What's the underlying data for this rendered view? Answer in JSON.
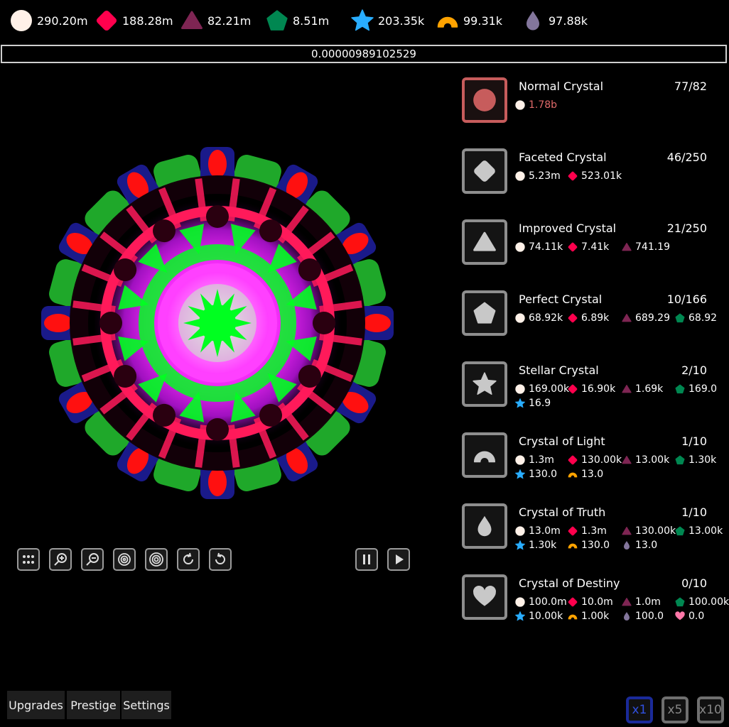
{
  "resources": [
    {
      "name": "circle",
      "value": "290.20m",
      "color": "#fff1e8"
    },
    {
      "name": "diamond",
      "value": "188.28m",
      "color": "#ff004d"
    },
    {
      "name": "triangle",
      "value": "82.21m",
      "color": "#7e2553"
    },
    {
      "name": "pentagon",
      "value": "8.51m",
      "color": "#008751"
    },
    {
      "name": "star",
      "value": "203.35k",
      "color": "#29adff"
    },
    {
      "name": "arc",
      "value": "99.31k",
      "color": "#ffa300"
    },
    {
      "name": "drop",
      "value": "97.88k",
      "color": "#83769c"
    }
  ],
  "progress_value": "0.00000989102529",
  "crystals": [
    {
      "name": "Normal Crystal",
      "count": "77/82",
      "icon": "circle-icon",
      "affordable": true,
      "costs": [
        {
          "res": "circle",
          "value": "1.78b",
          "highlight": true
        }
      ]
    },
    {
      "name": "Faceted Crystal",
      "count": "46/250",
      "icon": "diamond-icon",
      "costs": [
        {
          "res": "circle",
          "value": "5.23m"
        },
        {
          "res": "diamond",
          "value": "523.01k"
        }
      ]
    },
    {
      "name": "Improved Crystal",
      "count": "21/250",
      "icon": "triangle-icon",
      "costs": [
        {
          "res": "circle",
          "value": "74.11k"
        },
        {
          "res": "diamond",
          "value": "7.41k"
        },
        {
          "res": "triangle",
          "value": "741.19"
        }
      ]
    },
    {
      "name": "Perfect Crystal",
      "count": "10/166",
      "icon": "pentagon-icon",
      "costs": [
        {
          "res": "circle",
          "value": "68.92k"
        },
        {
          "res": "diamond",
          "value": "6.89k"
        },
        {
          "res": "triangle",
          "value": "689.29"
        },
        {
          "res": "pentagon",
          "value": "68.92"
        }
      ]
    },
    {
      "name": "Stellar Crystal",
      "count": "2/10",
      "icon": "star-icon",
      "costs": [
        {
          "res": "circle",
          "value": "169.00k"
        },
        {
          "res": "diamond",
          "value": "16.90k"
        },
        {
          "res": "triangle",
          "value": "1.69k"
        },
        {
          "res": "pentagon",
          "value": "169.0"
        },
        {
          "res": "star",
          "value": "16.9"
        }
      ]
    },
    {
      "name": "Crystal of Light",
      "count": "1/10",
      "icon": "arc-icon",
      "costs": [
        {
          "res": "circle",
          "value": "1.3m"
        },
        {
          "res": "diamond",
          "value": "130.00k"
        },
        {
          "res": "triangle",
          "value": "13.00k"
        },
        {
          "res": "pentagon",
          "value": "1.30k"
        },
        {
          "res": "star",
          "value": "130.0"
        },
        {
          "res": "arc",
          "value": "13.0"
        }
      ]
    },
    {
      "name": "Crystal of Truth",
      "count": "1/10",
      "icon": "drop-icon",
      "costs": [
        {
          "res": "circle",
          "value": "13.0m"
        },
        {
          "res": "diamond",
          "value": "1.3m"
        },
        {
          "res": "triangle",
          "value": "130.00k"
        },
        {
          "res": "pentagon",
          "value": "13.00k"
        },
        {
          "res": "star",
          "value": "1.30k"
        },
        {
          "res": "arc",
          "value": "130.0"
        },
        {
          "res": "drop",
          "value": "13.0"
        }
      ]
    },
    {
      "name": "Crystal of Destiny",
      "count": "0/10",
      "icon": "heart-icon",
      "costs": [
        {
          "res": "circle",
          "value": "100.0m"
        },
        {
          "res": "diamond",
          "value": "10.0m"
        },
        {
          "res": "triangle",
          "value": "1.0m"
        },
        {
          "res": "pentagon",
          "value": "100.00k"
        },
        {
          "res": "star",
          "value": "10.00k"
        },
        {
          "res": "arc",
          "value": "1.00k"
        },
        {
          "res": "drop",
          "value": "100.0"
        },
        {
          "res": "heart",
          "value": "0.0"
        }
      ]
    }
  ],
  "heart_color": "#ff77a8",
  "tools": [
    "grid-icon",
    "zoom-in-icon",
    "zoom-out-icon",
    "spiral-in-icon",
    "spiral-out-icon",
    "rotate-right-icon",
    "rotate-left-icon"
  ],
  "playback": [
    "pause-icon",
    "play-icon"
  ],
  "nav": {
    "upgrades": "Upgrades",
    "prestige": "Prestige",
    "settings": "Settings"
  },
  "multipliers": [
    {
      "label": "x1",
      "active": true
    },
    {
      "label": "x5"
    },
    {
      "label": "x10"
    }
  ],
  "kaleidoscope_colors": {
    "core": "#00ff20",
    "glow": "#ff30ff",
    "ring": "#ff1a5a",
    "outer_green": "#1fa82a",
    "outer_blue": "#1a1a8a",
    "outer_red": "#ff1010"
  }
}
